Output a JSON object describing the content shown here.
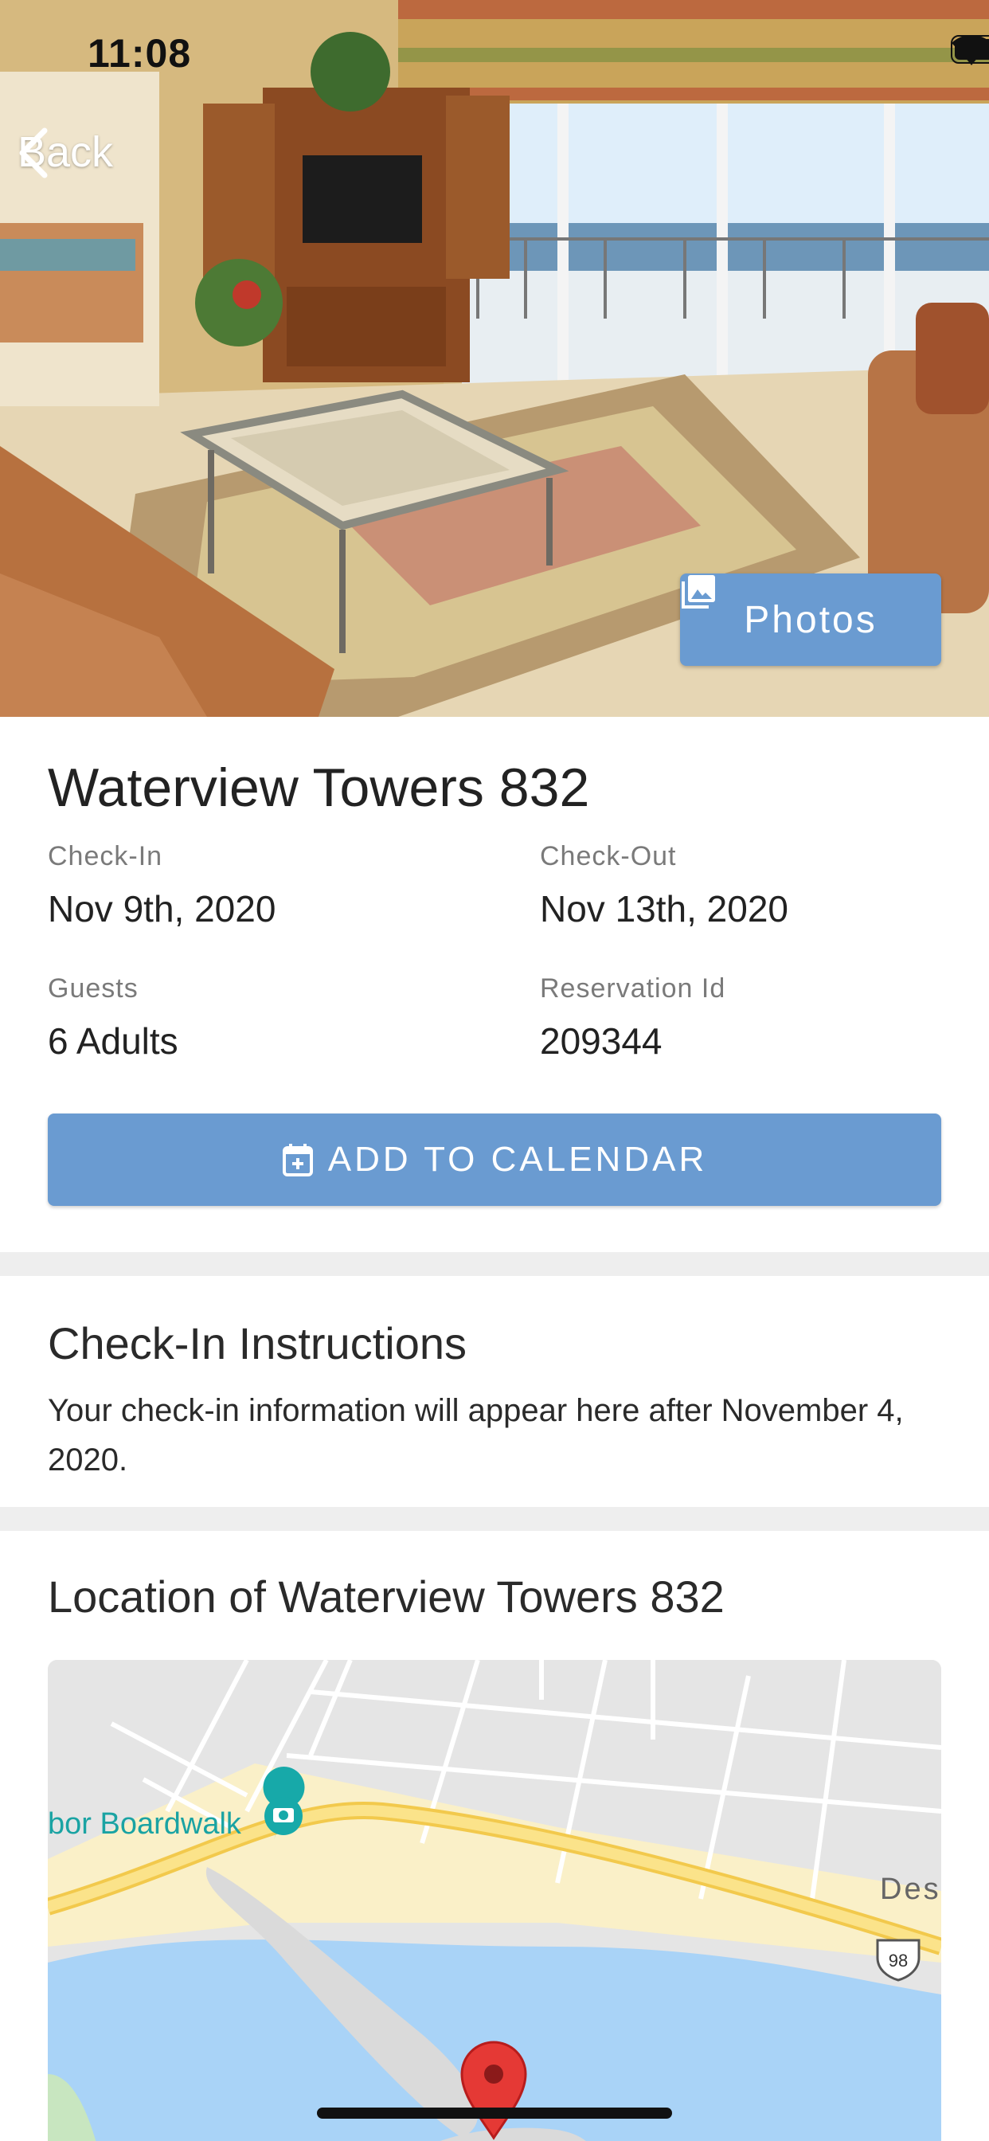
{
  "status_bar": {
    "time": "11:08"
  },
  "nav": {
    "back_label": "Back"
  },
  "hero": {
    "photos_label": "Photos"
  },
  "property": {
    "title": "Waterview Towers 832",
    "check_in_label": "Check-In",
    "check_in_value": "Nov 9th, 2020",
    "check_out_label": "Check-Out",
    "check_out_value": "Nov 13th, 2020",
    "guests_label": "Guests",
    "guests_value": "6 Adults",
    "reservation_label": "Reservation Id",
    "reservation_value": "209344",
    "calendar_button": "ADD TO CALENDAR"
  },
  "checkin_instructions": {
    "title": "Check-In Instructions",
    "text": "Your check-in information will appear here after November 4, 2020."
  },
  "location": {
    "title": "Location of Waterview Towers 832",
    "map_labels": {
      "poi": "bor Boardwalk",
      "partial_place": "Des",
      "highway_shield": "98"
    }
  },
  "colors": {
    "accent": "#6a9bd1",
    "divider": "#eeeeee",
    "map_water": "#a9d3f7",
    "map_road": "#f6e08a",
    "map_pin": "#e53935"
  }
}
